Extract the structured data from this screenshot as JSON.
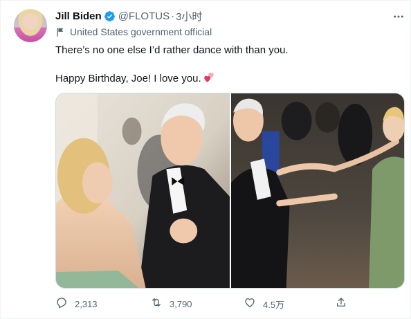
{
  "tweet": {
    "author": {
      "display_name": "Jill Biden",
      "handle": "@FLOTUS",
      "verified": true,
      "separator": "·",
      "timestamp": "3小时",
      "affiliation": "United States government official"
    },
    "text_lines": [
      "There’s no one else I’d rather dance with than you.",
      "",
      "Happy Birthday, Joe! I love you."
    ],
    "emoji": "two-hearts-icon",
    "media": [
      {
        "kind": "photo",
        "icon": "photo-dancing-couple"
      },
      {
        "kind": "photo",
        "icon": "photo-dancing-crowd"
      }
    ],
    "actions": {
      "reply_count": "2,313",
      "retweet_count": "3,790",
      "like_count": "4.5万"
    }
  },
  "colors": {
    "verified": "#1d9bf0",
    "secondary_text": "#536471",
    "primary_text": "#0f1419",
    "heart": "#f91880"
  }
}
